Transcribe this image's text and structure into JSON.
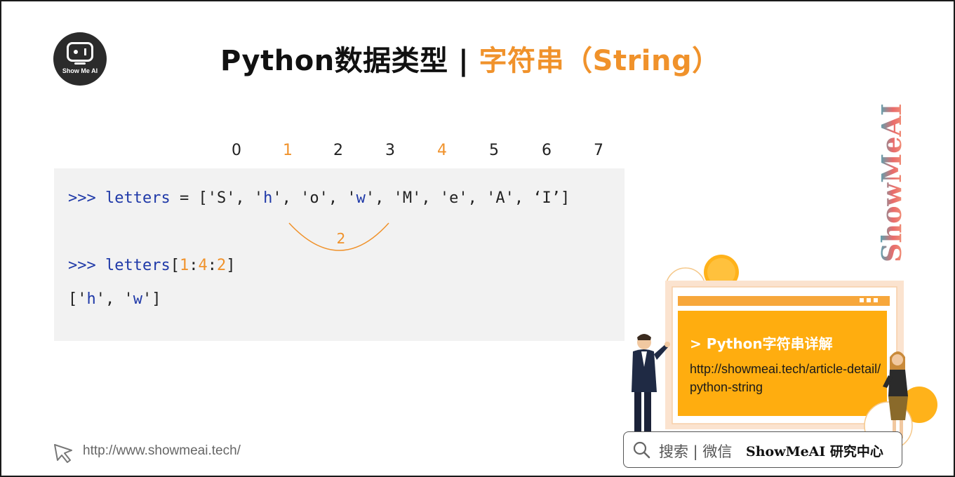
{
  "logo": {
    "text": "Show Me AI"
  },
  "title": {
    "main": "Python数据类型 | ",
    "highlight": "字符串（String）"
  },
  "watermark": {
    "text": "ShowMeAI"
  },
  "indices": [
    {
      "label": "0",
      "highlight": false
    },
    {
      "label": "1",
      "highlight": true
    },
    {
      "label": "2",
      "highlight": false
    },
    {
      "label": "3",
      "highlight": false
    },
    {
      "label": "4",
      "highlight": true
    },
    {
      "label": "5",
      "highlight": false
    },
    {
      "label": "6",
      "highlight": false
    },
    {
      "label": "7",
      "highlight": false
    }
  ],
  "code": {
    "prompt": ">>>",
    "line1": {
      "var": "letters",
      "assign": " = ['S', '",
      "h": "h",
      "mid1": "', 'o', '",
      "w": "w",
      "rest": "', 'M', 'e', 'A', ‘I’]"
    },
    "step_label": "2",
    "line2": {
      "var": "letters",
      "open": "[",
      "start": "1",
      "colon1": ":",
      "stop": "4",
      "colon2": ":",
      "step": "2",
      "close": "]"
    },
    "line3": {
      "open": "['",
      "h": "h",
      "mid": "', '",
      "w": "w",
      "close": "']"
    }
  },
  "footer": {
    "url": "http://www.showmeai.tech/"
  },
  "card": {
    "title": "> Python字符串详解",
    "url": "http://showmeai.tech/article-detail/python-string"
  },
  "search": {
    "text": "搜索 | 微信",
    "brand": "ShowMeAI 研究中心"
  },
  "colors": {
    "accent": "#f0922b",
    "keyword": "#1f39a8",
    "card": "#ffad0f"
  }
}
